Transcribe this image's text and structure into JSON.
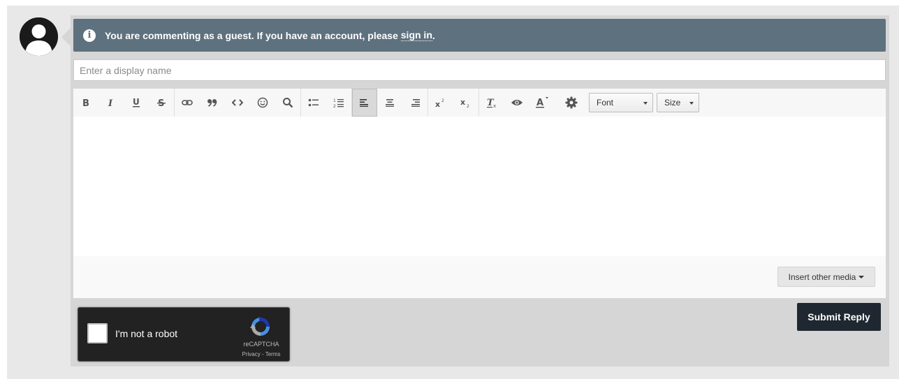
{
  "notice": {
    "text_before": "You are commenting as a guest. If you have an account, please",
    "link_label": "sign in",
    "text_after": "."
  },
  "display_name": {
    "placeholder": "Enter a display name",
    "value": ""
  },
  "toolbar": {
    "font_label": "Font",
    "size_label": "Size",
    "active_button": "align-left"
  },
  "footer": {
    "insert_media_label": "Insert other media"
  },
  "captcha": {
    "label": "I'm not a robot",
    "brand": "reCAPTCHA",
    "links": "Privacy - Terms"
  },
  "submit_label": "Submit Reply",
  "colors": {
    "notice_bg": "#5e717f",
    "submit_bg": "#1f2830",
    "panel_bg": "#d6d6d6",
    "captcha_bg": "#222222"
  }
}
